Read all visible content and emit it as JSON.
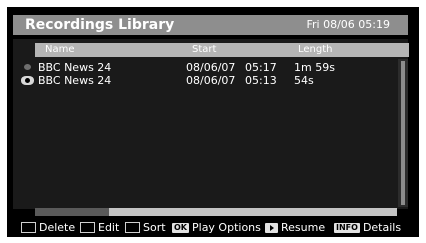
{
  "header": {
    "title": "Recordings Library",
    "datetime": "Fri 08/06 05:19"
  },
  "columns": {
    "name": "Name",
    "start": "Start",
    "length": "Length"
  },
  "recordings": [
    {
      "status_icon": "unwatched-dot-icon",
      "name": "BBC News 24",
      "start_date": "08/06/07",
      "start_time": "05:17",
      "length": "1m 59s"
    },
    {
      "status_icon": "eye-icon",
      "name": "BBC News 24",
      "start_date": "08/06/07",
      "start_time": "05:13",
      "length": "54s"
    }
  ],
  "footer": {
    "delete": {
      "swatch_icon": "red-button-icon",
      "label": "Delete"
    },
    "edit": {
      "swatch_icon": "green-button-icon",
      "label": "Edit"
    },
    "sort": {
      "swatch_icon": "yellow-button-icon",
      "label": "Sort"
    },
    "play_options": {
      "key": "OK",
      "label": "Play Options"
    },
    "resume": {
      "key_icon": "play-icon",
      "label": "Resume"
    },
    "details": {
      "key": "INFO",
      "label": "Details"
    }
  },
  "colors": {
    "title_bar": "#8e8e8e",
    "column_header": "#b5b5b5",
    "list_background": "#1a1a1a",
    "text": "#ffffff"
  }
}
